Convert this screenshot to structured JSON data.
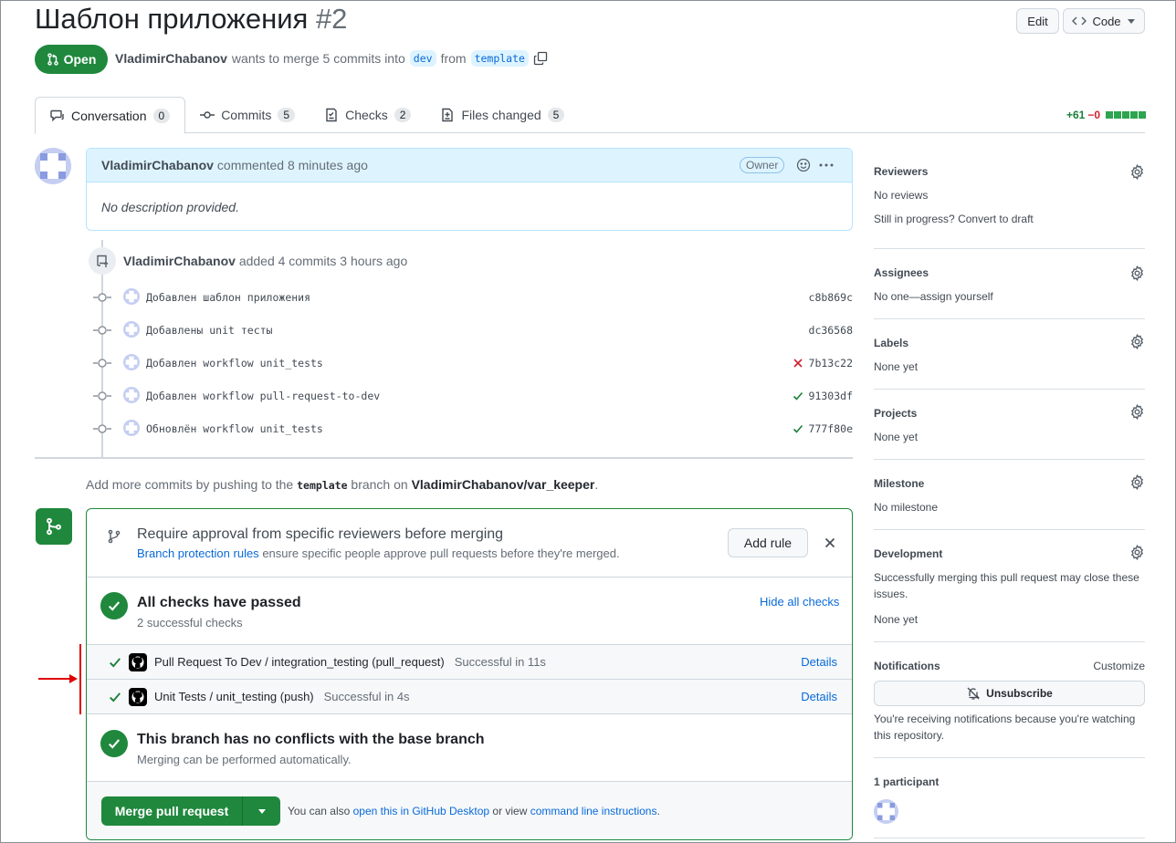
{
  "header": {
    "title": "Шаблон приложения",
    "number": "#2",
    "edit_label": "Edit",
    "code_label": "Code",
    "state": "Open",
    "author": "VladimirChabanov",
    "merge_text_1": "wants to merge 5 commits into",
    "base_branch": "dev",
    "merge_text_2": "from",
    "head_branch": "template"
  },
  "tabs": [
    {
      "label": "Conversation",
      "count": "0",
      "icon": "comment-icon"
    },
    {
      "label": "Commits",
      "count": "5",
      "icon": "commit-icon"
    },
    {
      "label": "Checks",
      "count": "2",
      "icon": "checklist-icon"
    },
    {
      "label": "Files changed",
      "count": "5",
      "icon": "file-diff-icon"
    }
  ],
  "diffstat": {
    "additions": "+61",
    "deletions": "−0"
  },
  "comment": {
    "author": "VladimirChabanov",
    "action": "commented 8 minutes ago",
    "owner_label": "Owner",
    "body": "No description provided."
  },
  "push_event": {
    "author": "VladimirChabanov",
    "text": "added 4 commits 3 hours ago"
  },
  "commits": [
    {
      "message": "Добавлен шаблон приложения",
      "sha": "c8b869c",
      "status": "none"
    },
    {
      "message": "Добавлены unit тесты",
      "sha": "dc36568",
      "status": "none"
    },
    {
      "message": "Добавлен workflow unit_tests",
      "sha": "7b13c22",
      "status": "fail"
    },
    {
      "message": "Добавлен workflow pull-request-to-dev",
      "sha": "91303df",
      "status": "pass"
    },
    {
      "message": "Обновлён workflow unit_tests",
      "sha": "777f80e",
      "status": "pass"
    }
  ],
  "push_hint": {
    "text_1": "Add more commits by pushing to the",
    "branch": "template",
    "text_2": "branch on",
    "repo": "VladimirChabanov/var_keeper",
    "text_3": "."
  },
  "merge_box": {
    "rule_title": "Require approval from specific reviewers before merging",
    "rule_link": "Branch protection rules",
    "rule_sub": "ensure specific people approve pull requests before they're merged.",
    "add_rule_label": "Add rule",
    "checks_title": "All checks have passed",
    "checks_sub": "2 successful checks",
    "hide_checks_label": "Hide all checks",
    "checks": [
      {
        "name": "Pull Request To Dev / integration_testing (pull_request)",
        "status": "Successful in 11s",
        "details": "Details"
      },
      {
        "name": "Unit Tests / unit_testing (push)",
        "status": "Successful in 4s",
        "details": "Details"
      }
    ],
    "conflict_title": "This branch has no conflicts with the base branch",
    "conflict_sub": "Merging can be performed automatically.",
    "merge_label": "Merge pull request",
    "note_1": "You can also",
    "note_link_1": "open this in GitHub Desktop",
    "note_2": "or view",
    "note_link_2": "command line instructions",
    "note_3": "."
  },
  "sidebar": {
    "reviewers": {
      "title": "Reviewers",
      "value": "No reviews",
      "progress_text": "Still in progress?",
      "progress_link": "Convert to draft"
    },
    "assignees": {
      "title": "Assignees",
      "value": "No one—",
      "link": "assign yourself"
    },
    "labels": {
      "title": "Labels",
      "value": "None yet"
    },
    "projects": {
      "title": "Projects",
      "value": "None yet"
    },
    "milestone": {
      "title": "Milestone",
      "value": "No milestone"
    },
    "development": {
      "title": "Development",
      "desc_1": "Successfully merging this pull request may close these",
      "desc_2": "issues.",
      "value": "None yet"
    },
    "notifications": {
      "title": "Notifications",
      "customize": "Customize",
      "unsubscribe": "Unsubscribe",
      "note_1": "You're receiving notifications because you're watching",
      "note_2": "this repository."
    },
    "participants": {
      "title": "1 participant"
    }
  },
  "colors": {
    "accent_green": "#1f883d",
    "link_blue": "#0969da",
    "annotation_red": "#e00000"
  }
}
